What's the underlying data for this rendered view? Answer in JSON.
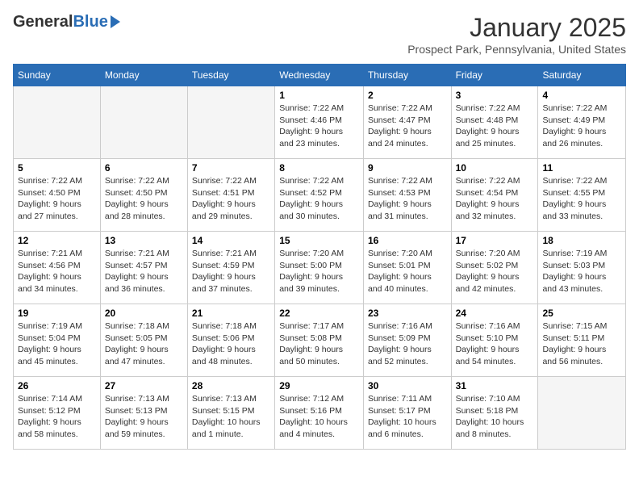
{
  "header": {
    "logo_general": "General",
    "logo_blue": "Blue",
    "month": "January 2025",
    "location": "Prospect Park, Pennsylvania, United States"
  },
  "days_of_week": [
    "Sunday",
    "Monday",
    "Tuesday",
    "Wednesday",
    "Thursday",
    "Friday",
    "Saturday"
  ],
  "weeks": [
    [
      {
        "day": "",
        "info": ""
      },
      {
        "day": "",
        "info": ""
      },
      {
        "day": "",
        "info": ""
      },
      {
        "day": "1",
        "info": "Sunrise: 7:22 AM\nSunset: 4:46 PM\nDaylight: 9 hours\nand 23 minutes."
      },
      {
        "day": "2",
        "info": "Sunrise: 7:22 AM\nSunset: 4:47 PM\nDaylight: 9 hours\nand 24 minutes."
      },
      {
        "day": "3",
        "info": "Sunrise: 7:22 AM\nSunset: 4:48 PM\nDaylight: 9 hours\nand 25 minutes."
      },
      {
        "day": "4",
        "info": "Sunrise: 7:22 AM\nSunset: 4:49 PM\nDaylight: 9 hours\nand 26 minutes."
      }
    ],
    [
      {
        "day": "5",
        "info": "Sunrise: 7:22 AM\nSunset: 4:50 PM\nDaylight: 9 hours\nand 27 minutes."
      },
      {
        "day": "6",
        "info": "Sunrise: 7:22 AM\nSunset: 4:50 PM\nDaylight: 9 hours\nand 28 minutes."
      },
      {
        "day": "7",
        "info": "Sunrise: 7:22 AM\nSunset: 4:51 PM\nDaylight: 9 hours\nand 29 minutes."
      },
      {
        "day": "8",
        "info": "Sunrise: 7:22 AM\nSunset: 4:52 PM\nDaylight: 9 hours\nand 30 minutes."
      },
      {
        "day": "9",
        "info": "Sunrise: 7:22 AM\nSunset: 4:53 PM\nDaylight: 9 hours\nand 31 minutes."
      },
      {
        "day": "10",
        "info": "Sunrise: 7:22 AM\nSunset: 4:54 PM\nDaylight: 9 hours\nand 32 minutes."
      },
      {
        "day": "11",
        "info": "Sunrise: 7:22 AM\nSunset: 4:55 PM\nDaylight: 9 hours\nand 33 minutes."
      }
    ],
    [
      {
        "day": "12",
        "info": "Sunrise: 7:21 AM\nSunset: 4:56 PM\nDaylight: 9 hours\nand 34 minutes."
      },
      {
        "day": "13",
        "info": "Sunrise: 7:21 AM\nSunset: 4:57 PM\nDaylight: 9 hours\nand 36 minutes."
      },
      {
        "day": "14",
        "info": "Sunrise: 7:21 AM\nSunset: 4:59 PM\nDaylight: 9 hours\nand 37 minutes."
      },
      {
        "day": "15",
        "info": "Sunrise: 7:20 AM\nSunset: 5:00 PM\nDaylight: 9 hours\nand 39 minutes."
      },
      {
        "day": "16",
        "info": "Sunrise: 7:20 AM\nSunset: 5:01 PM\nDaylight: 9 hours\nand 40 minutes."
      },
      {
        "day": "17",
        "info": "Sunrise: 7:20 AM\nSunset: 5:02 PM\nDaylight: 9 hours\nand 42 minutes."
      },
      {
        "day": "18",
        "info": "Sunrise: 7:19 AM\nSunset: 5:03 PM\nDaylight: 9 hours\nand 43 minutes."
      }
    ],
    [
      {
        "day": "19",
        "info": "Sunrise: 7:19 AM\nSunset: 5:04 PM\nDaylight: 9 hours\nand 45 minutes."
      },
      {
        "day": "20",
        "info": "Sunrise: 7:18 AM\nSunset: 5:05 PM\nDaylight: 9 hours\nand 47 minutes."
      },
      {
        "day": "21",
        "info": "Sunrise: 7:18 AM\nSunset: 5:06 PM\nDaylight: 9 hours\nand 48 minutes."
      },
      {
        "day": "22",
        "info": "Sunrise: 7:17 AM\nSunset: 5:08 PM\nDaylight: 9 hours\nand 50 minutes."
      },
      {
        "day": "23",
        "info": "Sunrise: 7:16 AM\nSunset: 5:09 PM\nDaylight: 9 hours\nand 52 minutes."
      },
      {
        "day": "24",
        "info": "Sunrise: 7:16 AM\nSunset: 5:10 PM\nDaylight: 9 hours\nand 54 minutes."
      },
      {
        "day": "25",
        "info": "Sunrise: 7:15 AM\nSunset: 5:11 PM\nDaylight: 9 hours\nand 56 minutes."
      }
    ],
    [
      {
        "day": "26",
        "info": "Sunrise: 7:14 AM\nSunset: 5:12 PM\nDaylight: 9 hours\nand 58 minutes."
      },
      {
        "day": "27",
        "info": "Sunrise: 7:13 AM\nSunset: 5:13 PM\nDaylight: 9 hours\nand 59 minutes."
      },
      {
        "day": "28",
        "info": "Sunrise: 7:13 AM\nSunset: 5:15 PM\nDaylight: 10 hours\nand 1 minute."
      },
      {
        "day": "29",
        "info": "Sunrise: 7:12 AM\nSunset: 5:16 PM\nDaylight: 10 hours\nand 4 minutes."
      },
      {
        "day": "30",
        "info": "Sunrise: 7:11 AM\nSunset: 5:17 PM\nDaylight: 10 hours\nand 6 minutes."
      },
      {
        "day": "31",
        "info": "Sunrise: 7:10 AM\nSunset: 5:18 PM\nDaylight: 10 hours\nand 8 minutes."
      },
      {
        "day": "",
        "info": ""
      }
    ]
  ]
}
